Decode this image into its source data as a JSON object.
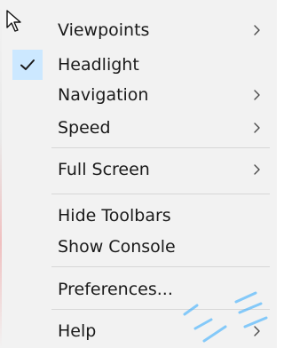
{
  "menu": {
    "items": [
      {
        "label": "Viewpoints",
        "submenu": true,
        "checked": false
      },
      {
        "label": "Headlight",
        "submenu": false,
        "checked": true
      },
      {
        "label": "Navigation",
        "submenu": true,
        "checked": false
      },
      {
        "label": "Speed",
        "submenu": true,
        "checked": false
      },
      {
        "label": "Full Screen",
        "submenu": true,
        "checked": false
      },
      {
        "label": "Hide Toolbars",
        "submenu": false,
        "checked": false
      },
      {
        "label": "Show Console",
        "submenu": false,
        "checked": false
      },
      {
        "label": "Preferences...",
        "submenu": false,
        "checked": false
      },
      {
        "label": "Help",
        "submenu": true,
        "checked": false
      }
    ]
  },
  "icons": {
    "cursor": "mouse-pointer-icon",
    "check": "checkmark-icon",
    "chevron": "chevron-right-icon"
  },
  "colors": {
    "menu_bg": "#f2f2f2",
    "highlight": "#cce8ff",
    "separator": "#d7d7d7",
    "text": "#1a1a1a",
    "watermark": "#2aa7ff"
  }
}
